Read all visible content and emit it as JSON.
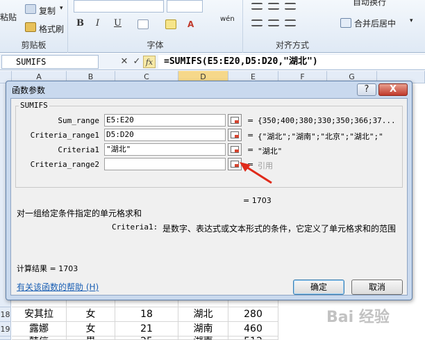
{
  "ribbon": {
    "clipboard": {
      "paste": "粘贴",
      "copy": "复制",
      "format_painter": "格式刷",
      "label": "剪贴板"
    },
    "font": {
      "label": "字体",
      "bold": "B",
      "italic": "I",
      "underline": "U",
      "wen": "wén"
    },
    "alignment": {
      "label": "对齐方式",
      "wrap": "自动换行",
      "merge": "合并后居中"
    }
  },
  "formula_bar": {
    "name_box": "SUMIFS",
    "cancel": "✕",
    "enter": "✓",
    "fx": "fx",
    "formula": "=SUMIFS(E5:E20,D5:D20,\"湖北\")"
  },
  "sheet": {
    "columns": [
      "A",
      "B",
      "C",
      "D",
      "E",
      "F",
      "G"
    ],
    "rows": [
      {
        "num": "18",
        "cells": [
          "安其拉",
          "女",
          "18",
          "湖北",
          "280"
        ]
      },
      {
        "num": "19",
        "cells": [
          "露娜",
          "女",
          "21",
          "湖南",
          "460"
        ]
      },
      {
        "num": "20",
        "cells": [
          "韩信",
          "男",
          "25",
          "湖南",
          "512"
        ]
      }
    ]
  },
  "dialog": {
    "title": "函数参数",
    "help_btn": "?",
    "close_btn": "X",
    "function_name": "SUMIFS",
    "args": [
      {
        "label": "Sum_range",
        "value": "E5:E20",
        "result": "{350;400;380;330;350;366;37..."
      },
      {
        "label": "Criteria_range1",
        "value": "D5:D20",
        "result": "{\"湖北\";\"湖南\";\"北京\";\"湖北\";\""
      },
      {
        "label": "Criteria1",
        "value": "\"湖北\"",
        "result": "\"湖北\""
      },
      {
        "label": "Criteria_range2",
        "value": "",
        "result": "引用"
      }
    ],
    "equals": "=",
    "formula_result_line": "= 1703",
    "description": "对一组给定条件指定的单元格求和",
    "arg_desc_name": "Criteria1:",
    "arg_desc": "是数字、表达式或文本形式的条件，它定义了单元格求和的范围",
    "calc_result": "计算结果 = 1703",
    "help_link": "有关该函数的帮助 (H)",
    "ok": "确定",
    "cancel": "取消"
  },
  "watermark": "Bai 经验",
  "colors": {
    "accent_arrow": "#e02a1a",
    "dialog_frame": "#c9d9ee",
    "ribbon_bg": "#dfe9f5"
  }
}
